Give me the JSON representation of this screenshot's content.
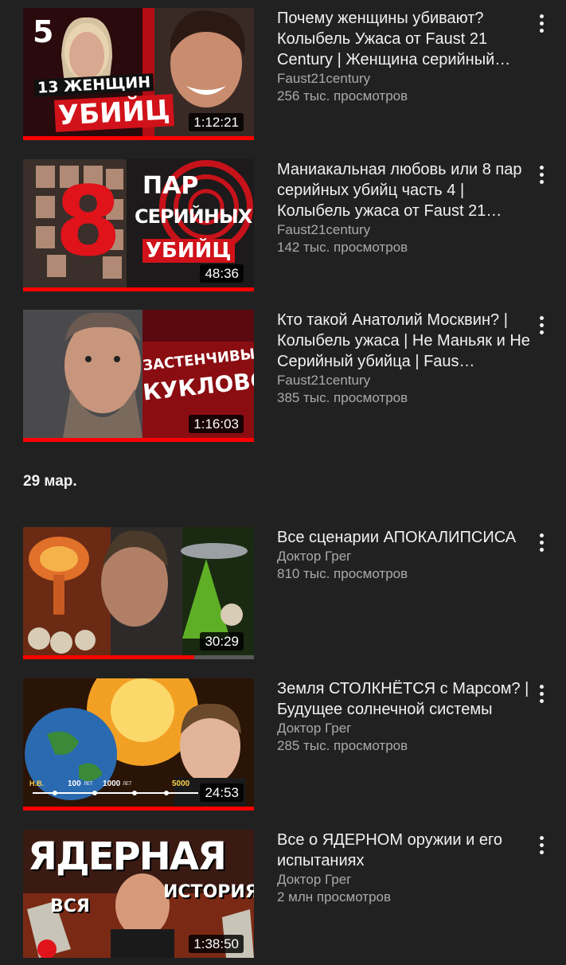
{
  "sections": [
    {
      "videos": [
        {
          "title": "Почему женщины убивают? Колыбель Ужаса от Faust 21 Century | Женщина серийный…",
          "channel": "Faust21century",
          "views": "256 тыс. просмотров",
          "duration": "1:12:21",
          "watched": 1.0,
          "thumb_text": [
            "5",
            "13 ЖЕНЩИН",
            "УБИЙЦ"
          ]
        },
        {
          "title": "Маниакальная любовь или 8 пар серийных убийц часть 4 | Колыбель ужаса от Faust 21…",
          "channel": "Faust21century",
          "views": "142 тыс. просмотров",
          "duration": "48:36",
          "watched": 1.0,
          "thumb_text": [
            "8",
            "ПАР",
            "СЕРИЙНЫХ",
            "УБИЙЦ"
          ]
        },
        {
          "title": "Кто такой Анатолий Москвин? | Колыбель ужаса | Не Маньяк и Не Серийный убийца | Faus…",
          "channel": "Faust21century",
          "views": "385 тыс. просмотров",
          "duration": "1:16:03",
          "watched": 1.0,
          "thumb_text": [
            "ЗАСТЕНЧИВЫЙ",
            "КУКЛОВОД"
          ]
        }
      ]
    },
    {
      "date": "29 мар.",
      "videos": [
        {
          "title": "Все сценарии АПОКАЛИПСИСА",
          "channel": "Доктор Грег",
          "views": "810 тыс. просмотров",
          "duration": "30:29",
          "watched": 0.74,
          "thumb_text": []
        },
        {
          "title": "Земля СТОЛКНЁТСЯ с Марсом? | Будущее солнечной системы",
          "channel": "Доктор Грег",
          "views": "285 тыс. просмотров",
          "duration": "24:53",
          "watched": 1.0,
          "thumb_text": [
            "Н.В.",
            "100",
            "ЛЕТ",
            "1000",
            "ЛЕТ",
            "5000"
          ]
        },
        {
          "title": "Все о ЯДЕРНОМ оружии и его испытаниях",
          "channel": "Доктор Грег",
          "views": "2 млн просмотров",
          "duration": "1:38:50",
          "watched": 1.0,
          "thumb_text": [
            "ЯДЕРНАЯ",
            "ВСЯ",
            "ИСТОРИЯ"
          ]
        }
      ]
    }
  ],
  "colors": {
    "background": "#212121",
    "progress": "#ff0000",
    "meta": "#aaaaaa"
  }
}
